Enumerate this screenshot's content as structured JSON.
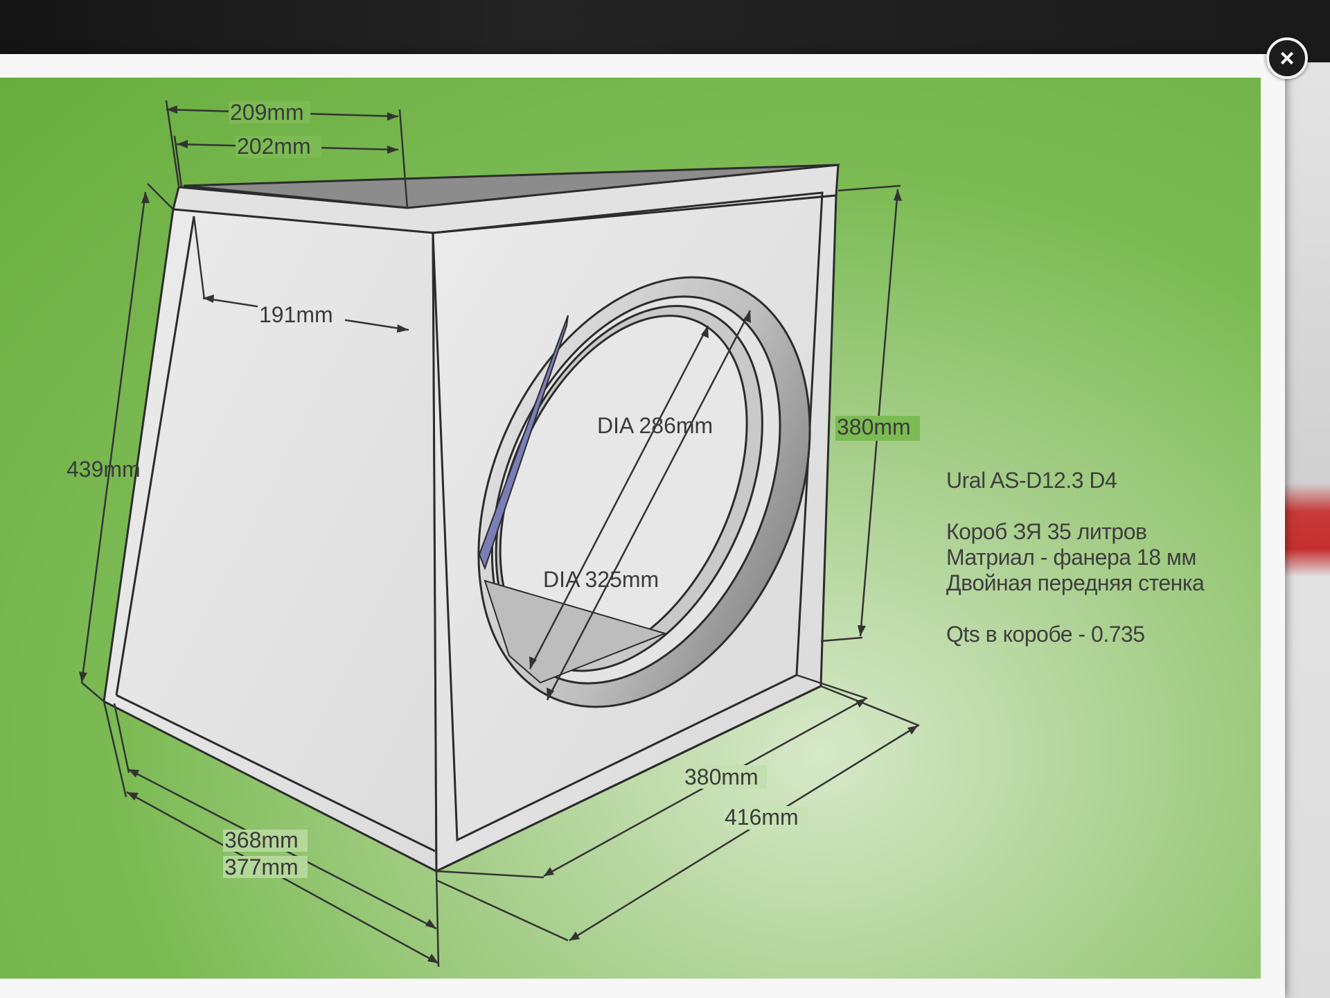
{
  "window": {
    "close_label": "×"
  },
  "dimensions": {
    "top_outer_depth": "209mm",
    "top_inner_depth": "202mm",
    "inner_depth": "191mm",
    "back_height": "439mm",
    "front_height": "380mm",
    "bottom_inner_depth": "368mm",
    "bottom_outer_depth": "377mm",
    "front_inner_width": "380mm",
    "front_outer_width": "416mm",
    "cutout_inner_dia": "DIA 286mm",
    "cutout_outer_dia": "DIA 325mm"
  },
  "notes": {
    "model": "Ural AS-D12.3 D4",
    "box_type": "Короб ЗЯ 35 литров",
    "material": "Матриал - фанера 18 мм",
    "front_wall": "Двойная передняя стенка",
    "qts": "Qts в коробе - 0.735"
  },
  "colors": {
    "background_green": "#7cbb54",
    "panel_fill": "#e6e6e6",
    "edge_stroke": "#2c2c2c",
    "cutout_blue": "#7a7fb8"
  }
}
